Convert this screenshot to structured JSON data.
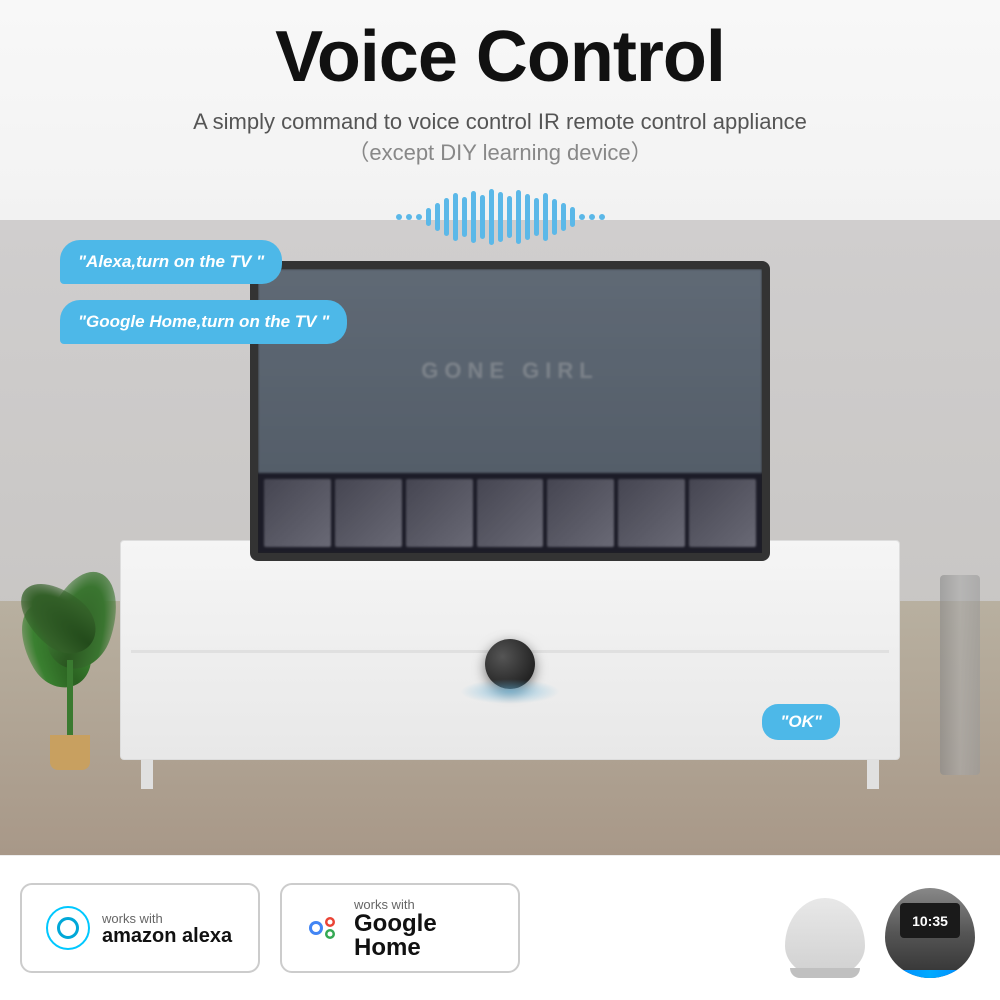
{
  "header": {
    "title": "Voice Control",
    "subtitle_main": "A simply command to voice control IR remote control appliance",
    "subtitle_parenthetical": "（except DIY learning device）"
  },
  "bubbles": {
    "bubble1": "\"Alexa,turn on the TV \"",
    "bubble2": "\"Google Home,turn on the TV \"",
    "bubble_ok": "\"OK\""
  },
  "tv_screen": {
    "movie_title": "GONE GIRL"
  },
  "badges": {
    "alexa": {
      "works_with": "works with",
      "brand": "amazon alexa"
    },
    "google": {
      "works_with": "works with",
      "brand": "Google Home"
    }
  },
  "echo_display": {
    "time": "10:35"
  }
}
